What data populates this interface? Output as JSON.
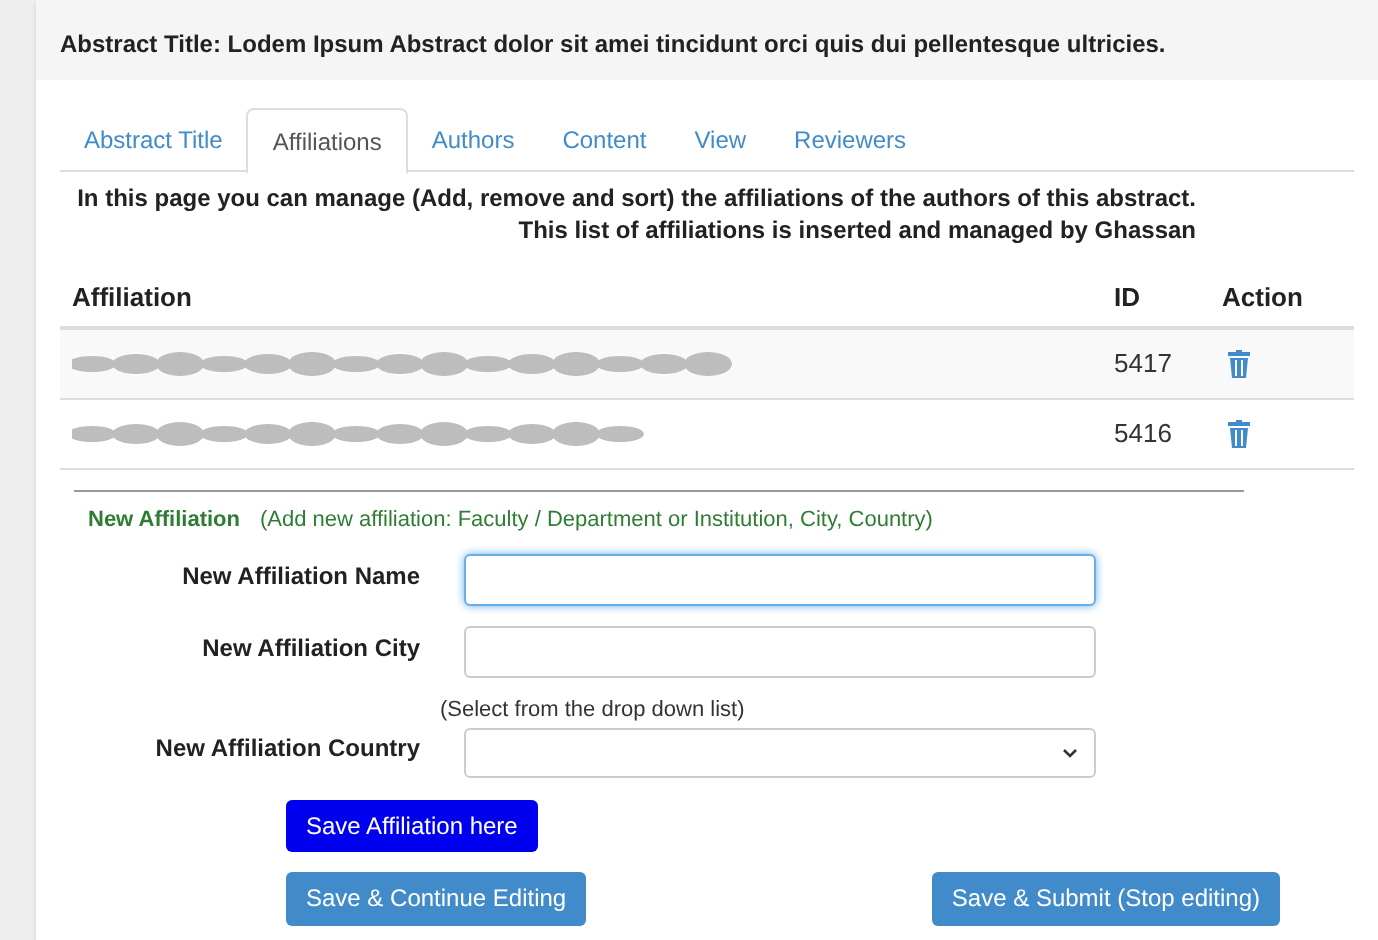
{
  "header": {
    "title": "Abstract Title: Lodem Ipsum Abstract dolor sit amei tincidunt orci quis dui pellentesque ultricies."
  },
  "tabs": [
    {
      "label": "Abstract Title",
      "selected": false
    },
    {
      "label": "Affiliations",
      "selected": true
    },
    {
      "label": "Authors",
      "selected": false
    },
    {
      "label": "Content",
      "selected": false
    },
    {
      "label": "View",
      "selected": false
    },
    {
      "label": "Reviewers",
      "selected": false
    }
  ],
  "intro": [
    "In this page you can manage (Add, remove and sort) the affiliations of the authors of this abstract.",
    "This list of affiliations is inserted and managed by Ghassan"
  ],
  "table": {
    "columns": [
      "Affiliation",
      "ID",
      "Action"
    ],
    "rows": [
      {
        "affiliation": {
          "kind": "redacted"
        },
        "id": "5417"
      },
      {
        "affiliation": {
          "kind": "redacted"
        },
        "id": "5416"
      }
    ]
  },
  "new_affiliation": {
    "title": "New Affiliation",
    "hint": "(Add new affiliation: Faculty / Department or Institution, City, Country)",
    "fields": [
      {
        "kind": "text",
        "label": "New Affiliation Name",
        "focused": true
      },
      {
        "kind": "text",
        "label": "New Affiliation City",
        "focused": false
      },
      {
        "kind": "select",
        "label": "New Affiliation Country",
        "note": "(Select from the drop down list)",
        "focused": false
      }
    ],
    "save_button": "Save Affiliation here"
  },
  "buttons": [
    "Save & Continue Editing",
    "Save & Submit (Stop editing)"
  ]
}
